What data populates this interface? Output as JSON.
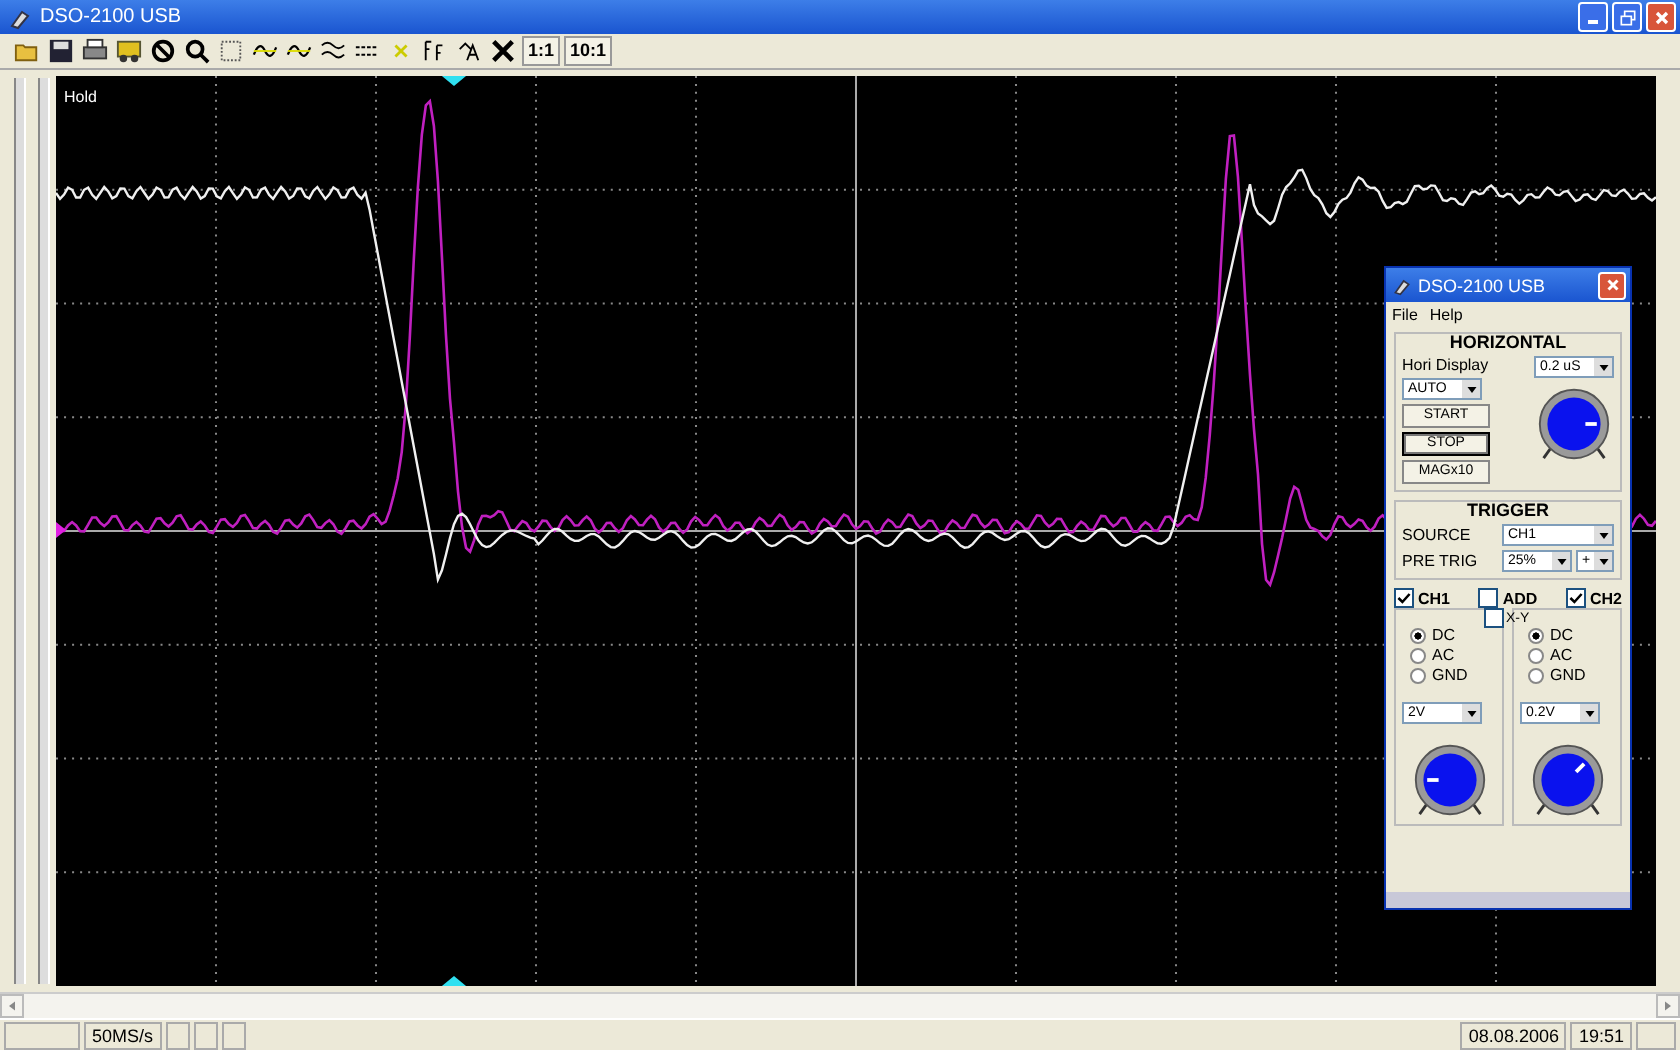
{
  "window": {
    "title": "DSO-2100 USB"
  },
  "toolbar": {
    "ratio_buttons": [
      {
        "label": "1:1"
      },
      {
        "label": "10:1"
      }
    ]
  },
  "screen": {
    "status_label": "Hold"
  },
  "control_panel": {
    "title": "DSO-2100 USB",
    "menu": [
      "File",
      "Help"
    ],
    "horizontal": {
      "heading": "HORIZONTAL",
      "display_label": "Hori Display",
      "timebase": "0.2 uS",
      "display_mode": "AUTO",
      "buttons": [
        {
          "label": "START",
          "selected": false
        },
        {
          "label": "STOP",
          "selected": true
        },
        {
          "label": "MAGx10",
          "selected": false
        }
      ]
    },
    "trigger": {
      "heading": "TRIGGER",
      "source_label": "SOURCE",
      "source": "CH1",
      "pretrig_label": "PRE TRIG",
      "pretrig": "25%",
      "slope": "+"
    },
    "add": {
      "label": "ADD",
      "checked": false
    },
    "xy": {
      "label": "X-Y",
      "checked": false
    },
    "channels": [
      {
        "label": "CH1",
        "checked": true,
        "coupling": [
          {
            "label": "DC",
            "selected": true
          },
          {
            "label": "AC",
            "selected": false
          },
          {
            "label": "GND",
            "selected": false
          }
        ],
        "volts": "2V"
      },
      {
        "label": "CH2",
        "checked": true,
        "coupling": [
          {
            "label": "DC",
            "selected": true
          },
          {
            "label": "AC",
            "selected": false
          },
          {
            "label": "GND",
            "selected": false
          }
        ],
        "volts": "0.2V"
      }
    ]
  },
  "status_bar": {
    "sample_rate": "50MS/s",
    "date": "08.08.2006",
    "time": "19:51"
  }
}
